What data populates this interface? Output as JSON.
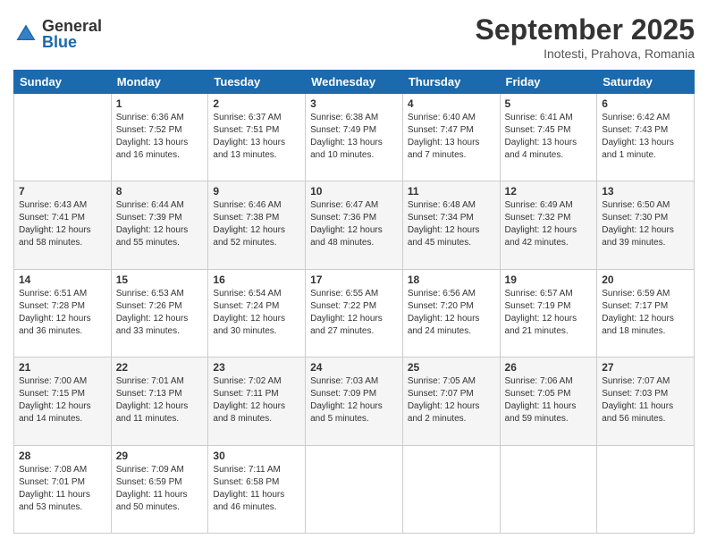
{
  "logo": {
    "general": "General",
    "blue": "Blue"
  },
  "title": "September 2025",
  "location": "Inotesti, Prahova, Romania",
  "days_of_week": [
    "Sunday",
    "Monday",
    "Tuesday",
    "Wednesday",
    "Thursday",
    "Friday",
    "Saturday"
  ],
  "weeks": [
    [
      {
        "day": "",
        "sunrise": "",
        "sunset": "",
        "daylight": ""
      },
      {
        "day": "1",
        "sunrise": "Sunrise: 6:36 AM",
        "sunset": "Sunset: 7:52 PM",
        "daylight": "Daylight: 13 hours and 16 minutes."
      },
      {
        "day": "2",
        "sunrise": "Sunrise: 6:37 AM",
        "sunset": "Sunset: 7:51 PM",
        "daylight": "Daylight: 13 hours and 13 minutes."
      },
      {
        "day": "3",
        "sunrise": "Sunrise: 6:38 AM",
        "sunset": "Sunset: 7:49 PM",
        "daylight": "Daylight: 13 hours and 10 minutes."
      },
      {
        "day": "4",
        "sunrise": "Sunrise: 6:40 AM",
        "sunset": "Sunset: 7:47 PM",
        "daylight": "Daylight: 13 hours and 7 minutes."
      },
      {
        "day": "5",
        "sunrise": "Sunrise: 6:41 AM",
        "sunset": "Sunset: 7:45 PM",
        "daylight": "Daylight: 13 hours and 4 minutes."
      },
      {
        "day": "6",
        "sunrise": "Sunrise: 6:42 AM",
        "sunset": "Sunset: 7:43 PM",
        "daylight": "Daylight: 13 hours and 1 minute."
      }
    ],
    [
      {
        "day": "7",
        "sunrise": "Sunrise: 6:43 AM",
        "sunset": "Sunset: 7:41 PM",
        "daylight": "Daylight: 12 hours and 58 minutes."
      },
      {
        "day": "8",
        "sunrise": "Sunrise: 6:44 AM",
        "sunset": "Sunset: 7:39 PM",
        "daylight": "Daylight: 12 hours and 55 minutes."
      },
      {
        "day": "9",
        "sunrise": "Sunrise: 6:46 AM",
        "sunset": "Sunset: 7:38 PM",
        "daylight": "Daylight: 12 hours and 52 minutes."
      },
      {
        "day": "10",
        "sunrise": "Sunrise: 6:47 AM",
        "sunset": "Sunset: 7:36 PM",
        "daylight": "Daylight: 12 hours and 48 minutes."
      },
      {
        "day": "11",
        "sunrise": "Sunrise: 6:48 AM",
        "sunset": "Sunset: 7:34 PM",
        "daylight": "Daylight: 12 hours and 45 minutes."
      },
      {
        "day": "12",
        "sunrise": "Sunrise: 6:49 AM",
        "sunset": "Sunset: 7:32 PM",
        "daylight": "Daylight: 12 hours and 42 minutes."
      },
      {
        "day": "13",
        "sunrise": "Sunrise: 6:50 AM",
        "sunset": "Sunset: 7:30 PM",
        "daylight": "Daylight: 12 hours and 39 minutes."
      }
    ],
    [
      {
        "day": "14",
        "sunrise": "Sunrise: 6:51 AM",
        "sunset": "Sunset: 7:28 PM",
        "daylight": "Daylight: 12 hours and 36 minutes."
      },
      {
        "day": "15",
        "sunrise": "Sunrise: 6:53 AM",
        "sunset": "Sunset: 7:26 PM",
        "daylight": "Daylight: 12 hours and 33 minutes."
      },
      {
        "day": "16",
        "sunrise": "Sunrise: 6:54 AM",
        "sunset": "Sunset: 7:24 PM",
        "daylight": "Daylight: 12 hours and 30 minutes."
      },
      {
        "day": "17",
        "sunrise": "Sunrise: 6:55 AM",
        "sunset": "Sunset: 7:22 PM",
        "daylight": "Daylight: 12 hours and 27 minutes."
      },
      {
        "day": "18",
        "sunrise": "Sunrise: 6:56 AM",
        "sunset": "Sunset: 7:20 PM",
        "daylight": "Daylight: 12 hours and 24 minutes."
      },
      {
        "day": "19",
        "sunrise": "Sunrise: 6:57 AM",
        "sunset": "Sunset: 7:19 PM",
        "daylight": "Daylight: 12 hours and 21 minutes."
      },
      {
        "day": "20",
        "sunrise": "Sunrise: 6:59 AM",
        "sunset": "Sunset: 7:17 PM",
        "daylight": "Daylight: 12 hours and 18 minutes."
      }
    ],
    [
      {
        "day": "21",
        "sunrise": "Sunrise: 7:00 AM",
        "sunset": "Sunset: 7:15 PM",
        "daylight": "Daylight: 12 hours and 14 minutes."
      },
      {
        "day": "22",
        "sunrise": "Sunrise: 7:01 AM",
        "sunset": "Sunset: 7:13 PM",
        "daylight": "Daylight: 12 hours and 11 minutes."
      },
      {
        "day": "23",
        "sunrise": "Sunrise: 7:02 AM",
        "sunset": "Sunset: 7:11 PM",
        "daylight": "Daylight: 12 hours and 8 minutes."
      },
      {
        "day": "24",
        "sunrise": "Sunrise: 7:03 AM",
        "sunset": "Sunset: 7:09 PM",
        "daylight": "Daylight: 12 hours and 5 minutes."
      },
      {
        "day": "25",
        "sunrise": "Sunrise: 7:05 AM",
        "sunset": "Sunset: 7:07 PM",
        "daylight": "Daylight: 12 hours and 2 minutes."
      },
      {
        "day": "26",
        "sunrise": "Sunrise: 7:06 AM",
        "sunset": "Sunset: 7:05 PM",
        "daylight": "Daylight: 11 hours and 59 minutes."
      },
      {
        "day": "27",
        "sunrise": "Sunrise: 7:07 AM",
        "sunset": "Sunset: 7:03 PM",
        "daylight": "Daylight: 11 hours and 56 minutes."
      }
    ],
    [
      {
        "day": "28",
        "sunrise": "Sunrise: 7:08 AM",
        "sunset": "Sunset: 7:01 PM",
        "daylight": "Daylight: 11 hours and 53 minutes."
      },
      {
        "day": "29",
        "sunrise": "Sunrise: 7:09 AM",
        "sunset": "Sunset: 6:59 PM",
        "daylight": "Daylight: 11 hours and 50 minutes."
      },
      {
        "day": "30",
        "sunrise": "Sunrise: 7:11 AM",
        "sunset": "Sunset: 6:58 PM",
        "daylight": "Daylight: 11 hours and 46 minutes."
      },
      {
        "day": "",
        "sunrise": "",
        "sunset": "",
        "daylight": ""
      },
      {
        "day": "",
        "sunrise": "",
        "sunset": "",
        "daylight": ""
      },
      {
        "day": "",
        "sunrise": "",
        "sunset": "",
        "daylight": ""
      },
      {
        "day": "",
        "sunrise": "",
        "sunset": "",
        "daylight": ""
      }
    ]
  ]
}
